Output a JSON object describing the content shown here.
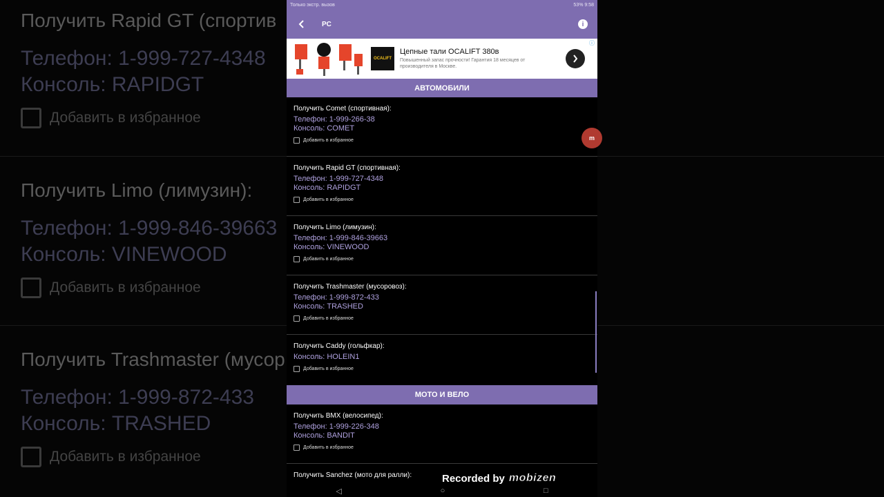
{
  "status_bar": {
    "left": "Только экстр. вызов",
    "right": "53% 9:58"
  },
  "app_bar": {
    "title": "PC"
  },
  "ad": {
    "logo": "OCALIFT",
    "headline": "Цепные тали OCALIFT 380в",
    "subtext": "Повышенный запас прочности! Гарантия 18 месяцев от производителя в Москве."
  },
  "sections": {
    "cars": "АВТОМОБИЛИ",
    "bikes": "МОТО И ВЕЛО"
  },
  "fav_label": "Добавить в избранное",
  "cars": [
    {
      "name": "Получить Comet (спортивная):",
      "phone": "Телефон: 1-999-266-38",
      "console": "Консоль: COMET"
    },
    {
      "name": "Получить Rapid GT (спортивная):",
      "phone": "Телефон: 1-999-727-4348",
      "console": "Консоль: RAPIDGT"
    },
    {
      "name": "Получить Limo (лимузин):",
      "phone": "Телефон: 1-999-846-39663",
      "console": "Консоль: VINEWOOD"
    },
    {
      "name": "Получить Trashmaster (мусоровоз):",
      "phone": "Телефон: 1-999-872-433",
      "console": "Консоль: TRASHED"
    },
    {
      "name": "Получить Caddy (гольфкар):",
      "console": "Консоль: HOLEIN1"
    }
  ],
  "bikes": [
    {
      "name": "Получить BMX (велосипед):",
      "phone": "Телефон: 1-999-226-348",
      "console": "Консоль: BANDIT"
    },
    {
      "name": "Получить Sanchez (мото для ралли):"
    }
  ],
  "background": {
    "entries": [
      {
        "name": "Получить Rapid GT (спортив",
        "phone": "Телефон: 1-999-727-4348",
        "console": "Консоль: RAPIDGT",
        "fav": "Добавить в избранное"
      },
      {
        "name": "Получить Limo (лимузин):",
        "phone": "Телефон: 1-999-846-39663",
        "console": "Консоль: VINEWOOD",
        "fav": "Добавить в избранное"
      },
      {
        "name": "Получить Trashmaster (мусор",
        "phone": "Телефон: 1-999-872-433",
        "console": "Консоль: TRASHED",
        "fav": "Добавить в избранное"
      }
    ]
  },
  "overlay": {
    "recorded_by": "Recorded by",
    "brand": "mobizen",
    "bubble": "m"
  },
  "colors": {
    "accent": "#7e6db0",
    "code_text": "#b0a2e0"
  }
}
